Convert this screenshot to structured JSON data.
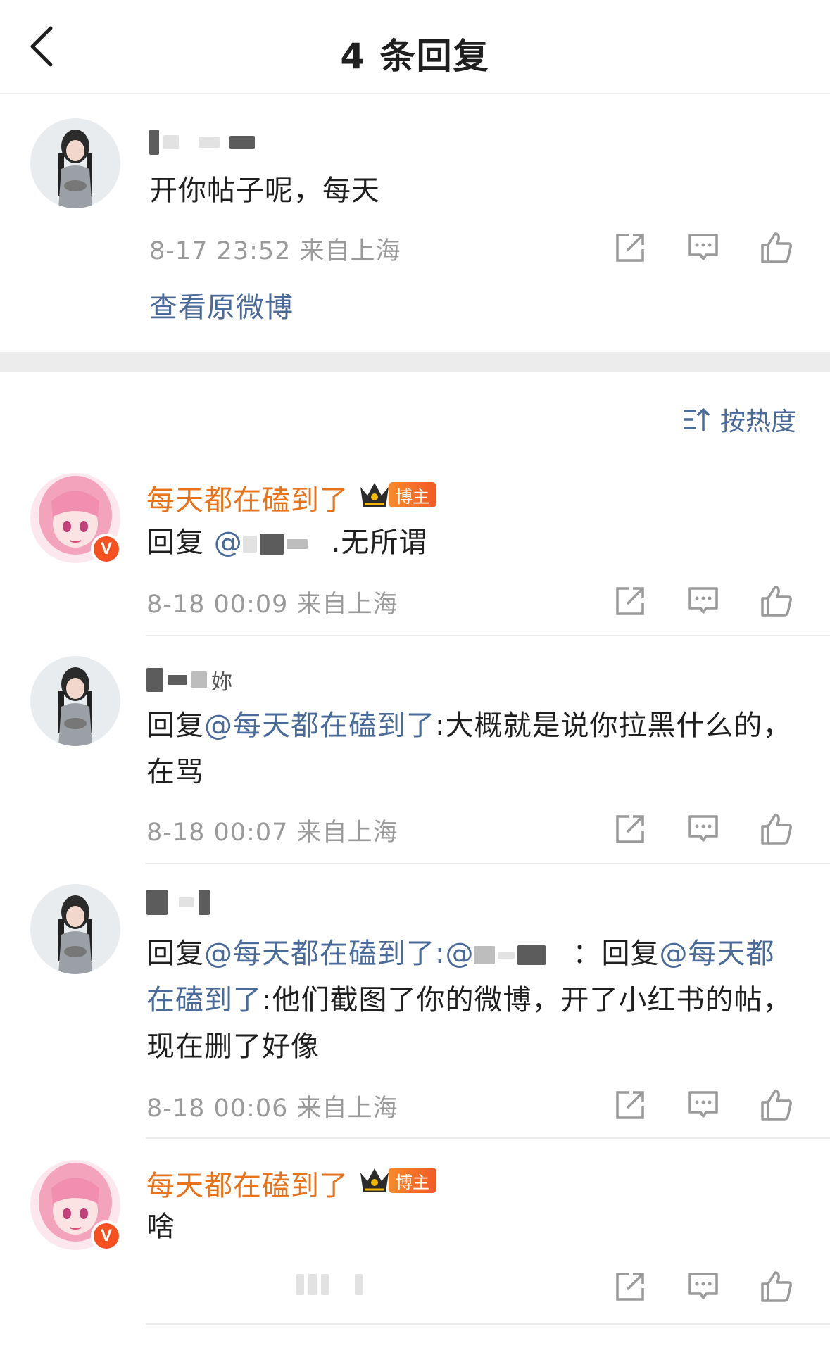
{
  "header": {
    "title": "4 条回复"
  },
  "original": {
    "text": "开你帖子呢，每天",
    "meta": "8-17 23:52  来自上海",
    "view_link": "查看原微博"
  },
  "sort": {
    "label": "按热度"
  },
  "replies": [
    {
      "name": "每天都在磕到了",
      "badge": "博主",
      "verified": "V",
      "prefix": "回复",
      "mention": "@",
      "text": ".无所谓",
      "meta": "8-18 00:09  来自上海"
    },
    {
      "name_suffix": "妳",
      "prefix": "回复",
      "mention": "@每天都在磕到了",
      "text": ":大概就是说你拉黑什么的，在骂",
      "meta": "8-18 00:07  来自上海"
    },
    {
      "prefix": "回复",
      "mention": "@每天都在磕到了",
      "mention2_prefix": ":@",
      "middle": "：回复",
      "mention2": "@每天都在磕到了",
      "text": ":他们截图了你的微博，开了小红书的帖，现在删了好像",
      "meta": "8-18 00:06  来自上海"
    },
    {
      "name": "每天都在磕到了",
      "badge": "博主",
      "verified": "V",
      "text": "啥"
    }
  ],
  "colors": {
    "accent_link": "#4a6a9a",
    "name_orange": "#e8731b",
    "meta_gray": "#9a9a9a"
  }
}
